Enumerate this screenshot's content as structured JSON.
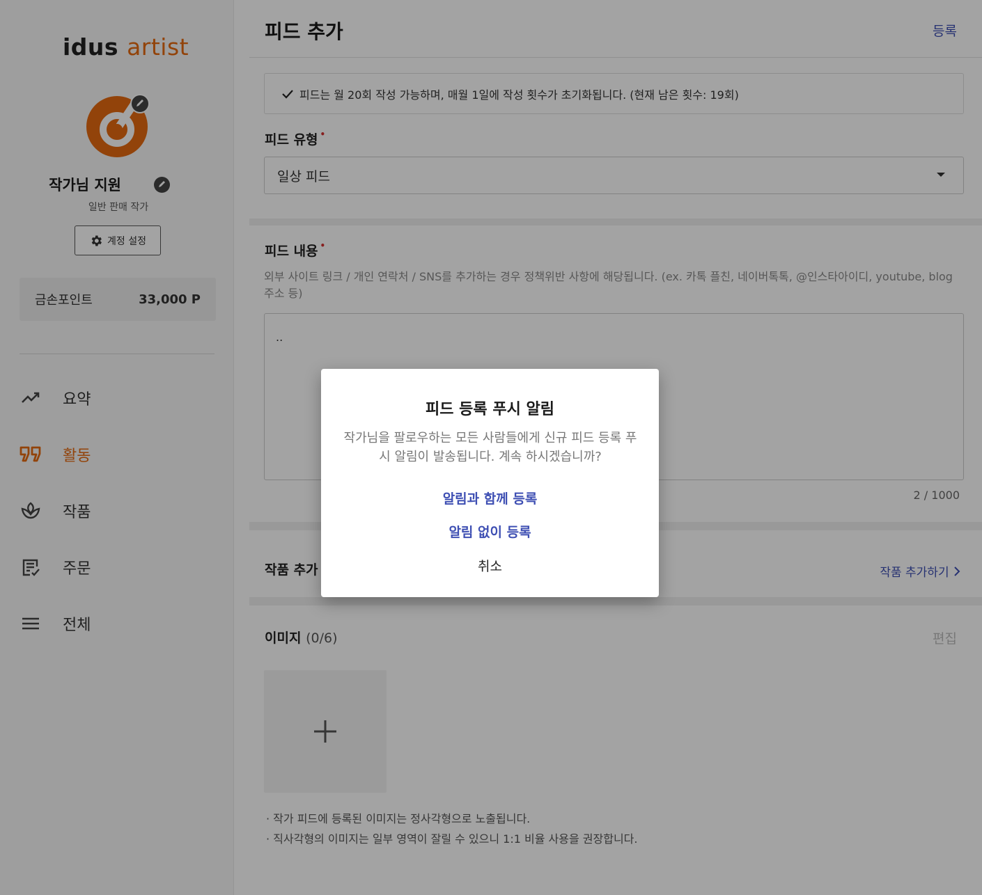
{
  "brand": {
    "logo_idus": "idus",
    "logo_artist": "artist",
    "accent": "#e56a10",
    "link": "#3e4fb3"
  },
  "profile": {
    "name": "작가님 지원",
    "role": "일반 판매 작가",
    "account_button": "계정 설정"
  },
  "points": {
    "label": "금손포인트",
    "value": "33,000 P"
  },
  "nav": [
    {
      "label": "요약",
      "icon": "trending-up-icon",
      "active": false
    },
    {
      "label": "활동",
      "icon": "quote-icon",
      "active": true
    },
    {
      "label": "작품",
      "icon": "plant-icon",
      "active": false
    },
    {
      "label": "주문",
      "icon": "order-list-icon",
      "active": false
    },
    {
      "label": "전체",
      "icon": "menu-icon",
      "active": false
    }
  ],
  "header": {
    "title": "피드 추가",
    "register": "등록"
  },
  "notice": {
    "text": "피드는 월 20회 작성 가능하며, 매월 1일에 작성 횟수가 초기화됩니다. (현재 남은 횟수: 19회)"
  },
  "feed_type": {
    "label": "피드 유형",
    "required": "•",
    "value": "일상 피드"
  },
  "feed_content": {
    "label": "피드 내용",
    "required": "•",
    "helper": "외부 사이트 링크 / 개인 연락처 / SNS를 추가하는 경우 정책위반 사항에 해당됩니다. (ex. 카톡 플친, 네이버톡톡, @인스타아이디, youtube, blog 주소 등)",
    "value": "..",
    "counter": "2 / 1000"
  },
  "product": {
    "label": "작품 추가",
    "add_link": "작품 추가하기"
  },
  "images": {
    "label": "이미지",
    "count": "(0/6)",
    "edit": "편집",
    "notes": [
      "·  작가 피드에 등록된 이미지는 정사각형으로 노출됩니다.",
      "·  직사각형의 이미지는 일부 영역이 잘릴 수 있으니 1:1 비율 사용을 권장합니다."
    ]
  },
  "dialog": {
    "title": "피드 등록 푸시 알림",
    "message": "작가님을 팔로우하는 모든 사람들에게 신규 피드 등록 푸시 알림이 발송됩니다. 계속 하시겠습니까?",
    "confirm_with_push": "알림과 함께 등록",
    "confirm_without_push": "알림 없이 등록",
    "cancel": "취소"
  }
}
